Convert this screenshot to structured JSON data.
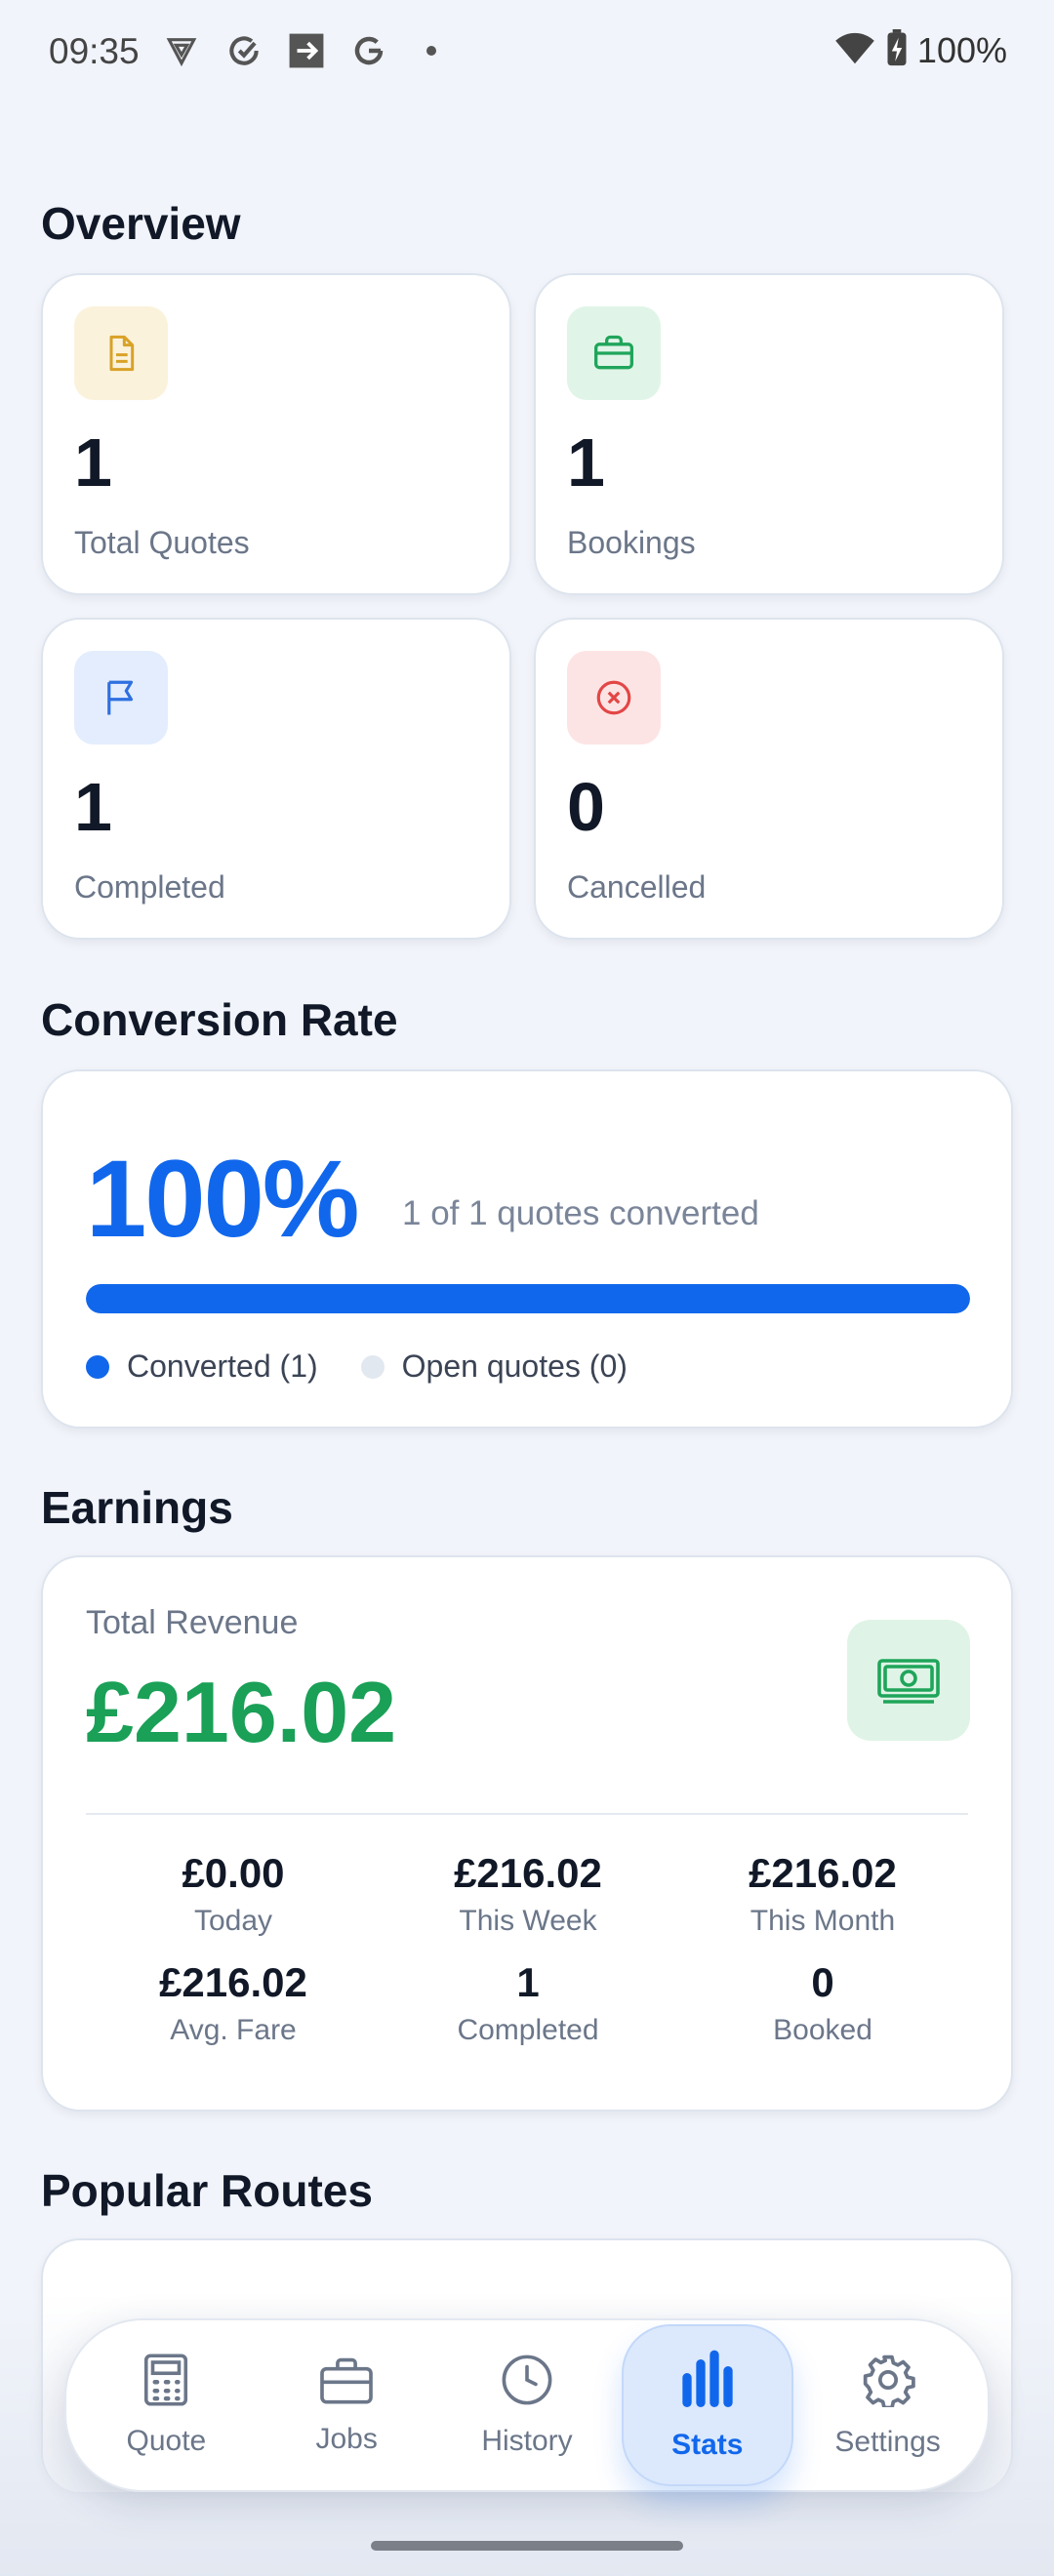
{
  "status_bar": {
    "time": "09:35",
    "battery": "100%",
    "icons": [
      "shield-icon",
      "sync-icon",
      "arrow-box-icon",
      "google-icon",
      "dot-icon",
      "wifi-icon",
      "battery-icon"
    ]
  },
  "overview": {
    "title": "Overview",
    "cards": [
      {
        "value": "1",
        "label": "Total Quotes",
        "icon": "document-icon",
        "icon_color": "#d9a227",
        "icon_bg": "#fbf2dc"
      },
      {
        "value": "1",
        "label": "Bookings",
        "icon": "briefcase-icon",
        "icon_color": "#1fa55a",
        "icon_bg": "#e0f5e8"
      },
      {
        "value": "1",
        "label": "Completed",
        "icon": "flag-icon",
        "icon_color": "#2f6fe0",
        "icon_bg": "#e3edfd"
      },
      {
        "value": "0",
        "label": "Cancelled",
        "icon": "x-circle-icon",
        "icon_color": "#e34646",
        "icon_bg": "#fde4e4"
      }
    ]
  },
  "conversion": {
    "title": "Conversion Rate",
    "rate": "100%",
    "rate_fraction": 1.0,
    "subtitle": "1 of 1 quotes converted",
    "legend": [
      {
        "label": "Converted (1)",
        "color": "#1167ec"
      },
      {
        "label": "Open quotes (0)",
        "color": "#e2e8f0"
      }
    ]
  },
  "earnings": {
    "title": "Earnings",
    "total_label": "Total Revenue",
    "total_value": "£216.02",
    "metrics": [
      {
        "value": "£0.00",
        "label": "Today"
      },
      {
        "value": "£216.02",
        "label": "This Week"
      },
      {
        "value": "£216.02",
        "label": "This Month"
      },
      {
        "value": "£216.02",
        "label": "Avg. Fare"
      },
      {
        "value": "1",
        "label": "Completed"
      },
      {
        "value": "0",
        "label": "Booked"
      }
    ]
  },
  "popular_routes": {
    "title": "Popular Routes"
  },
  "nav": {
    "items": [
      {
        "label": "Quote",
        "icon": "calculator-icon"
      },
      {
        "label": "Jobs",
        "icon": "briefcase-icon"
      },
      {
        "label": "History",
        "icon": "clock-icon"
      },
      {
        "label": "Stats",
        "icon": "bar-chart-icon",
        "active": true
      },
      {
        "label": "Settings",
        "icon": "gear-icon"
      }
    ]
  }
}
